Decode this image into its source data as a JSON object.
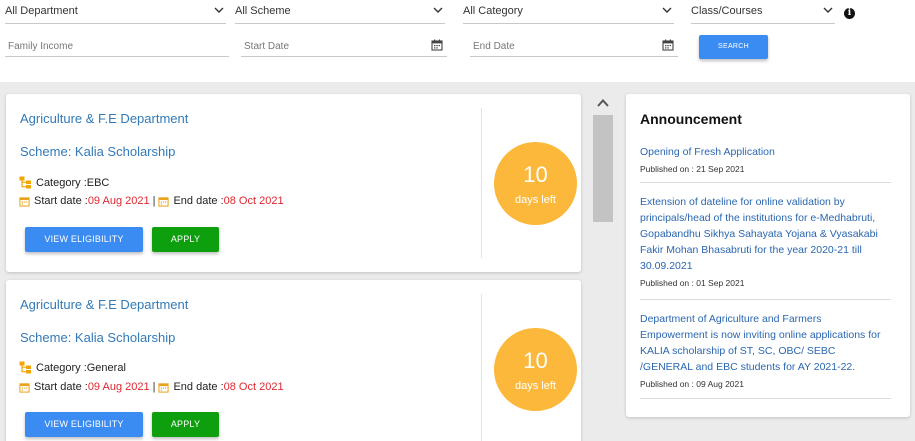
{
  "filters": {
    "department": "All Department",
    "scheme": "All Scheme",
    "category": "All Category",
    "class_courses": "Class/Courses",
    "family_income_placeholder": "Family Income",
    "start_date_placeholder": "Start Date",
    "end_date_placeholder": "End Date",
    "search_label": "SEARCH",
    "info_glyph": "i"
  },
  "cards": [
    {
      "department": "Agriculture & F.E Department",
      "scheme": "Scheme: Kalia Scholarship",
      "category_label": "Category : ",
      "category": "EBC",
      "start_label": "Start date : ",
      "start_date": "09 Aug 2021",
      "end_label": "End date : ",
      "end_date": "08 Oct 2021",
      "days_num": "10",
      "days_label": "days left",
      "eligibility_label": "VIEW ELIGIBILITY",
      "apply_label": "APPLY"
    },
    {
      "department": "Agriculture & F.E Department",
      "scheme": "Scheme: Kalia Scholarship",
      "category_label": "Category : ",
      "category": "General",
      "start_label": "Start date : ",
      "start_date": "09 Aug 2021",
      "end_label": "End date : ",
      "end_date": "08 Oct 2021",
      "days_num": "10",
      "days_label": "days left",
      "eligibility_label": "VIEW ELIGIBILITY",
      "apply_label": "APPLY"
    }
  ],
  "announcements": {
    "title": "Announcement",
    "items": [
      {
        "text": "Opening of Fresh Application",
        "published": "Published on : 21 Sep 2021"
      },
      {
        "text": "Extension of dateline for online validation by principals/head of the institutions for e-Medhabruti, Gopabandhu Sikhya Sahayata Yojana & Vyasakabi Fakir Mohan Bhasabruti for the year 2020-21 till 30.09.2021",
        "published": "Published on : 01 Sep 2021"
      },
      {
        "text": "Department of Agriculture and Farmers Empowerment is now inviting online applications for KALIA scholarship of ST, SC, OBC/ SEBC /GENERAL and EBC students for AY 2021-22.",
        "published": "Published on : 09 Aug 2021"
      }
    ]
  },
  "colors": {
    "link_blue": "#337ab7",
    "button_blue": "#3b8cf2",
    "apply_green": "#0d9f0d",
    "badge_orange": "#fbb83a",
    "date_red": "#e0272f"
  },
  "icons": {
    "dropdown": "chevron-down-icon",
    "date_picker": "calendar-icon",
    "category": "hierarchy-icon",
    "info": "info-icon",
    "scroll": "chevron-up-icon"
  }
}
